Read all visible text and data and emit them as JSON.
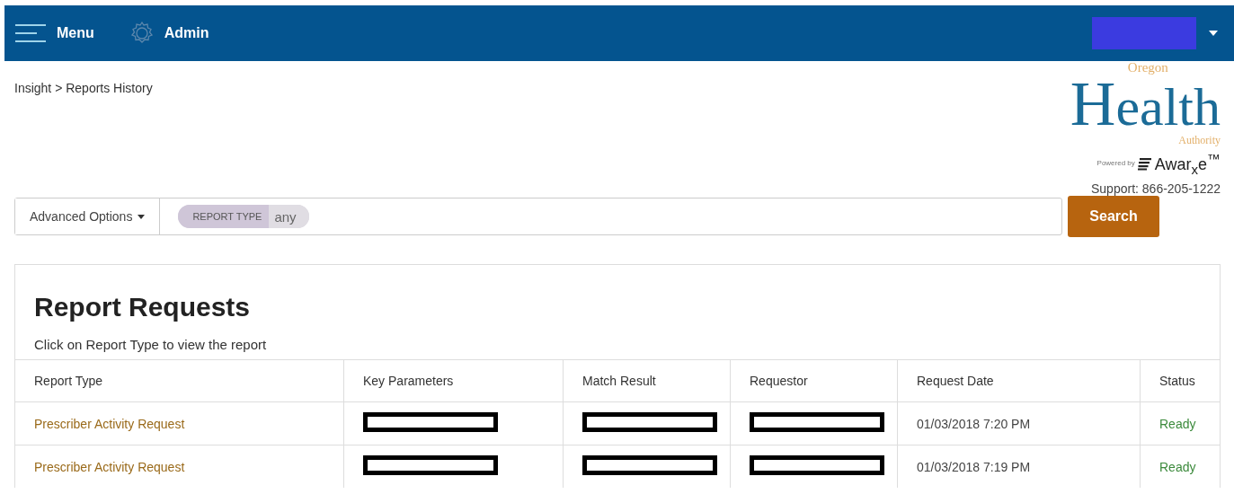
{
  "navbar": {
    "menu_label": "Menu",
    "admin_label": "Admin",
    "user": {
      "redacted": true
    }
  },
  "breadcrumb": "Insight > Reports History",
  "logo": {
    "top": "Oregon",
    "letter": "H",
    "rest": "ealth",
    "bottom": "Authority",
    "powered_by": "Powered by",
    "brand": "Awar$_{x}$e$^{™}$"
  },
  "support": "Support: 866-205-1222",
  "search": {
    "advanced_label": "Advanced Options",
    "filter_key": "REPORT TYPE",
    "filter_value": "any",
    "button": "Search"
  },
  "report_requests": {
    "title": "Report Requests",
    "hint": "Click on Report Type to view the report",
    "columns": [
      "Report Type",
      "Key Parameters",
      "Match Result",
      "Requestor",
      "Request Date",
      "Status"
    ],
    "rows": [
      {
        "report_type": "Prescriber Activity Request",
        "key_parameters": {
          "redacted": true
        },
        "match_result": {
          "redacted": true
        },
        "requestor": {
          "redacted": true
        },
        "request_date": "01/03/2018 7:20 PM",
        "status": "Ready"
      },
      {
        "report_type": "Prescriber Activity Request",
        "key_parameters": {
          "redacted": true
        },
        "match_result": {
          "redacted": true
        },
        "requestor": {
          "redacted": true
        },
        "request_date": "01/03/2018 7:19 PM",
        "status": "Ready"
      }
    ]
  }
}
